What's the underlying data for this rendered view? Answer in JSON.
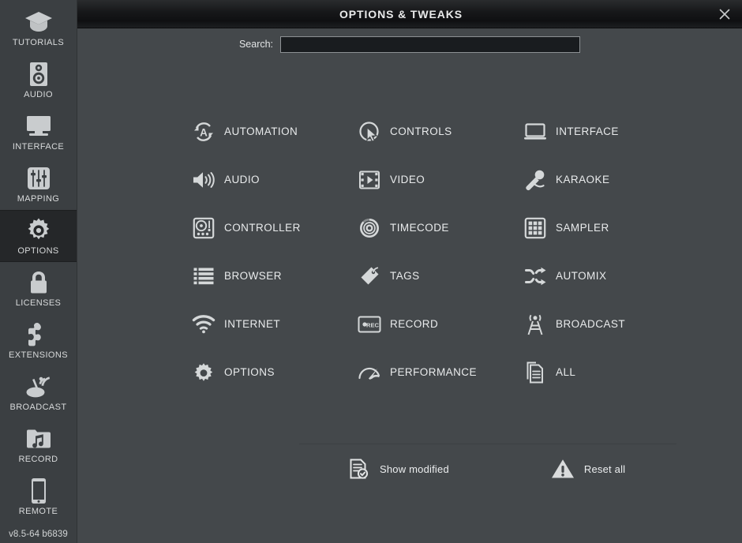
{
  "window": {
    "title": "OPTIONS & TWEAKS",
    "close_icon": "close-icon",
    "background_color": "#44488b"
  },
  "sidebar": {
    "version": "v8.5-64 b6839",
    "items": [
      {
        "label": "TUTORIALS",
        "icon": "graduation-cap-icon",
        "selected": false
      },
      {
        "label": "AUDIO",
        "icon": "speaker-icon",
        "selected": false
      },
      {
        "label": "INTERFACE",
        "icon": "monitor-icon",
        "selected": false
      },
      {
        "label": "MAPPING",
        "icon": "sliders-icon",
        "selected": false
      },
      {
        "label": "OPTIONS",
        "icon": "gear-icon",
        "selected": true
      },
      {
        "label": "LICENSES",
        "icon": "padlock-icon",
        "selected": false
      },
      {
        "label": "EXTENSIONS",
        "icon": "puzzle-piece-icon",
        "selected": false
      },
      {
        "label": "BROADCAST",
        "icon": "satellite-dish-icon",
        "selected": false
      },
      {
        "label": "RECORD",
        "icon": "music-folder-icon",
        "selected": false
      },
      {
        "label": "REMOTE",
        "icon": "smartphone-icon",
        "selected": false
      }
    ]
  },
  "search": {
    "label": "Search:",
    "value": "",
    "placeholder": ""
  },
  "categories": [
    {
      "label": "AUTOMATION",
      "icon": "automation-icon"
    },
    {
      "label": "CONTROLS",
      "icon": "cursor-circle-icon"
    },
    {
      "label": "INTERFACE",
      "icon": "laptop-icon"
    },
    {
      "label": "AUDIO",
      "icon": "volume-icon"
    },
    {
      "label": "VIDEO",
      "icon": "film-play-icon"
    },
    {
      "label": "KARAOKE",
      "icon": "microphone-icon"
    },
    {
      "label": "CONTROLLER",
      "icon": "turntable-icon"
    },
    {
      "label": "TIMECODE",
      "icon": "vinyl-record-icon"
    },
    {
      "label": "SAMPLER",
      "icon": "grid-pads-icon"
    },
    {
      "label": "BROWSER",
      "icon": "list-icon"
    },
    {
      "label": "TAGS",
      "icon": "tag-icon"
    },
    {
      "label": "AUTOMIX",
      "icon": "shuffle-icon"
    },
    {
      "label": "INTERNET",
      "icon": "wifi-icon"
    },
    {
      "label": "RECORD",
      "icon": "rec-button-icon"
    },
    {
      "label": "BROADCAST",
      "icon": "antenna-tower-icon"
    },
    {
      "label": "OPTIONS",
      "icon": "gear-icon"
    },
    {
      "label": "PERFORMANCE",
      "icon": "gauge-icon"
    },
    {
      "label": "ALL",
      "icon": "documents-icon"
    }
  ],
  "footer": {
    "buttons": [
      {
        "label": "Show modified",
        "icon": "document-check-icon"
      },
      {
        "label": "Reset all",
        "icon": "warning-triangle-icon"
      }
    ]
  }
}
